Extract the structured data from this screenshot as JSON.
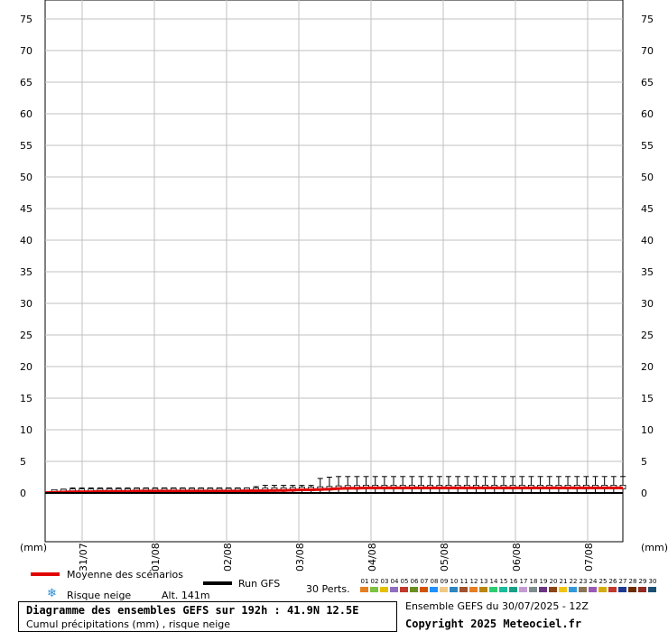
{
  "chart_data": {
    "type": "line",
    "ylim": [
      0,
      75
    ],
    "y_ticks": [
      75,
      70,
      65,
      60,
      55,
      50,
      45,
      40,
      35,
      30,
      25,
      20,
      15,
      10,
      5,
      0
    ],
    "unit_label": "(mm)",
    "dates": [
      "31/07",
      "01/08",
      "02/08",
      "03/08",
      "04/08",
      "05/08",
      "06/08",
      "07/08"
    ],
    "grid": true,
    "series": [
      {
        "name": "Moyenne des scénarios",
        "color": "#e00000",
        "values": [
          0.05,
          0.1,
          0.15,
          0.2,
          0.2,
          0.2,
          0.25,
          0.25,
          0.25,
          0.25,
          0.3,
          0.3,
          0.3,
          0.3,
          0.3,
          0.3,
          0.3,
          0.3,
          0.3,
          0.3,
          0.3,
          0.3,
          0.35,
          0.35,
          0.35,
          0.4,
          0.4,
          0.45,
          0.5,
          0.5,
          0.55,
          0.6,
          0.7,
          0.75,
          0.75,
          0.8,
          0.8,
          0.8,
          0.8,
          0.8,
          0.8,
          0.8,
          0.8,
          0.8,
          0.8,
          0.8,
          0.8,
          0.8,
          0.8,
          0.8,
          0.8,
          0.8,
          0.8,
          0.8,
          0.8,
          0.8,
          0.8,
          0.8,
          0.8,
          0.8,
          0.8,
          0.8,
          0.8,
          0.8
        ]
      },
      {
        "name": "Run GFS",
        "color": "#000000",
        "values": [
          0,
          0,
          0,
          0,
          0,
          0,
          0,
          0,
          0,
          0,
          0,
          0,
          0,
          0,
          0,
          0,
          0,
          0,
          0,
          0,
          0,
          0,
          0,
          0,
          0,
          0,
          0,
          0,
          0,
          0,
          0,
          0,
          0,
          0,
          0,
          0,
          0,
          0,
          0,
          0,
          0,
          0,
          0,
          0,
          0,
          0,
          0,
          0,
          0,
          0,
          0,
          0,
          0,
          0,
          0,
          0,
          0,
          0,
          0,
          0,
          0,
          0,
          0,
          0
        ]
      }
    ],
    "spread_max": [
      0,
      0.3,
      0.6,
      0.8,
      0.8,
      0.8,
      0.8,
      0.8,
      0.8,
      0.8,
      0.8,
      0.8,
      0.8,
      0.8,
      0.8,
      0.8,
      0.8,
      0.8,
      0.8,
      0.8,
      0.8,
      0.8,
      0.8,
      1,
      1.2,
      1.2,
      1.2,
      1.2,
      1.2,
      1.2,
      2.3,
      2.5,
      2.6,
      2.6,
      2.6,
      2.6,
      2.6,
      2.6,
      2.6,
      2.6,
      2.6,
      2.6,
      2.6,
      2.6,
      2.6,
      2.6,
      2.6,
      2.6,
      2.6,
      2.6,
      2.6,
      2.6,
      2.6,
      2.6,
      2.6,
      2.6,
      2.6,
      2.6,
      2.6,
      2.6,
      2.6,
      2.6,
      2.6,
      2.6
    ]
  },
  "legend": {
    "mean_label": "Moyenne des scénarios",
    "run_label": "Run GFS",
    "snow_label": "Risque neige",
    "alt_label": "Alt. 141m",
    "perts_label": "30 Perts.",
    "snow_icon": "snowflake-icon",
    "perts": [
      {
        "n": "01",
        "c": "#e67e22"
      },
      {
        "n": "02",
        "c": "#7dc242"
      },
      {
        "n": "03",
        "c": "#e5c000"
      },
      {
        "n": "04",
        "c": "#8e6fbf"
      },
      {
        "n": "05",
        "c": "#c0392b"
      },
      {
        "n": "06",
        "c": "#6b8e23"
      },
      {
        "n": "07",
        "c": "#d35400"
      },
      {
        "n": "08",
        "c": "#1e90ff"
      },
      {
        "n": "09",
        "c": "#f0c987"
      },
      {
        "n": "10",
        "c": "#2e86c1"
      },
      {
        "n": "11",
        "c": "#a0522d"
      },
      {
        "n": "12",
        "c": "#e67e22"
      },
      {
        "n": "13",
        "c": "#b8860b"
      },
      {
        "n": "14",
        "c": "#2ecc71"
      },
      {
        "n": "15",
        "c": "#1abc9c"
      },
      {
        "n": "16",
        "c": "#16a085"
      },
      {
        "n": "17",
        "c": "#c39bd3"
      },
      {
        "n": "18",
        "c": "#7f8c8d"
      },
      {
        "n": "19",
        "c": "#6c3483"
      },
      {
        "n": "20",
        "c": "#8b4513"
      },
      {
        "n": "21",
        "c": "#f1c40f"
      },
      {
        "n": "22",
        "c": "#3498db"
      },
      {
        "n": "23",
        "c": "#8b7355"
      },
      {
        "n": "24",
        "c": "#9b59b6"
      },
      {
        "n": "25",
        "c": "#d4ac0d"
      },
      {
        "n": "26",
        "c": "#c0392b"
      },
      {
        "n": "27",
        "c": "#1f3a93"
      },
      {
        "n": "28",
        "c": "#6e2c00"
      },
      {
        "n": "29",
        "c": "#922b21"
      },
      {
        "n": "30",
        "c": "#1b4f72"
      }
    ]
  },
  "footer": {
    "title": "Diagramme des ensembles GEFS sur 192h : 41.9N 12.5E",
    "subtitle": "Cumul précipitations (mm) , risque neige",
    "run_info": "Ensemble GEFS du 30/07/2025 - 12Z",
    "copyright": "Copyright 2025 Meteociel.fr"
  }
}
